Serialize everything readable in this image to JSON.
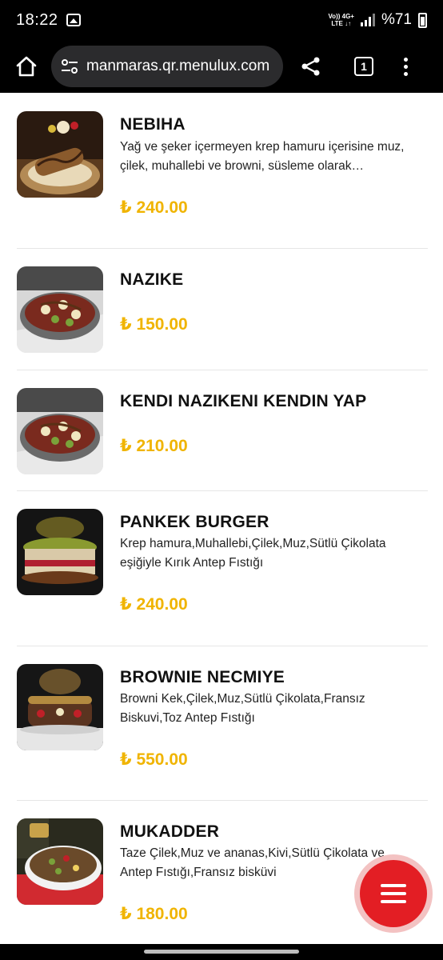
{
  "status_bar": {
    "time": "18:22",
    "network_top": "Vo)) 4G+",
    "network_bottom": "LTE ↓↑",
    "battery": "%71"
  },
  "browser": {
    "url": "manmaras.qr.menulux.com",
    "tab_count": "1"
  },
  "menu_items": [
    {
      "name": "NEBIHA",
      "description": "Yağ ve şeker içermeyen krep hamuru içerisine muz, çilek, muhallebi ve browni, süsleme olarak…",
      "price": "₺ 240.00"
    },
    {
      "name": "NAZIKE",
      "description": "",
      "price": "₺ 150.00"
    },
    {
      "name": "KENDI NAZIKENI KENDIN YAP",
      "description": "",
      "price": "₺ 210.00"
    },
    {
      "name": "PANKEK BURGER",
      "description": "Krep hamura,Muhallebi,Çilek,Muz,Sütlü Çikolata eşiğiyle Kırık Antep Fıstığı",
      "price": "₺ 240.00"
    },
    {
      "name": "BROWNIE NECMIYE",
      "description": "Browni Kek,Çilek,Muz,Sütlü Çikolata,Fransız Biskuvi,Toz Antep Fıstığı",
      "price": "₺ 550.00"
    },
    {
      "name": "MUKADDER",
      "description": "Taze Çilek,Muz ve ananas,Kivi,Sütlü Çikolata ve Antep Fıstığı,Fransız bisküvi",
      "price": "₺ 180.00"
    }
  ],
  "colors": {
    "price": "#f0b400",
    "fab": "#e31e24",
    "browser_bar": "#000000"
  },
  "icons": {
    "fab": "menu-hamburger-icon",
    "home": "home-icon",
    "share": "share-icon",
    "site_settings": "tune-icon"
  }
}
